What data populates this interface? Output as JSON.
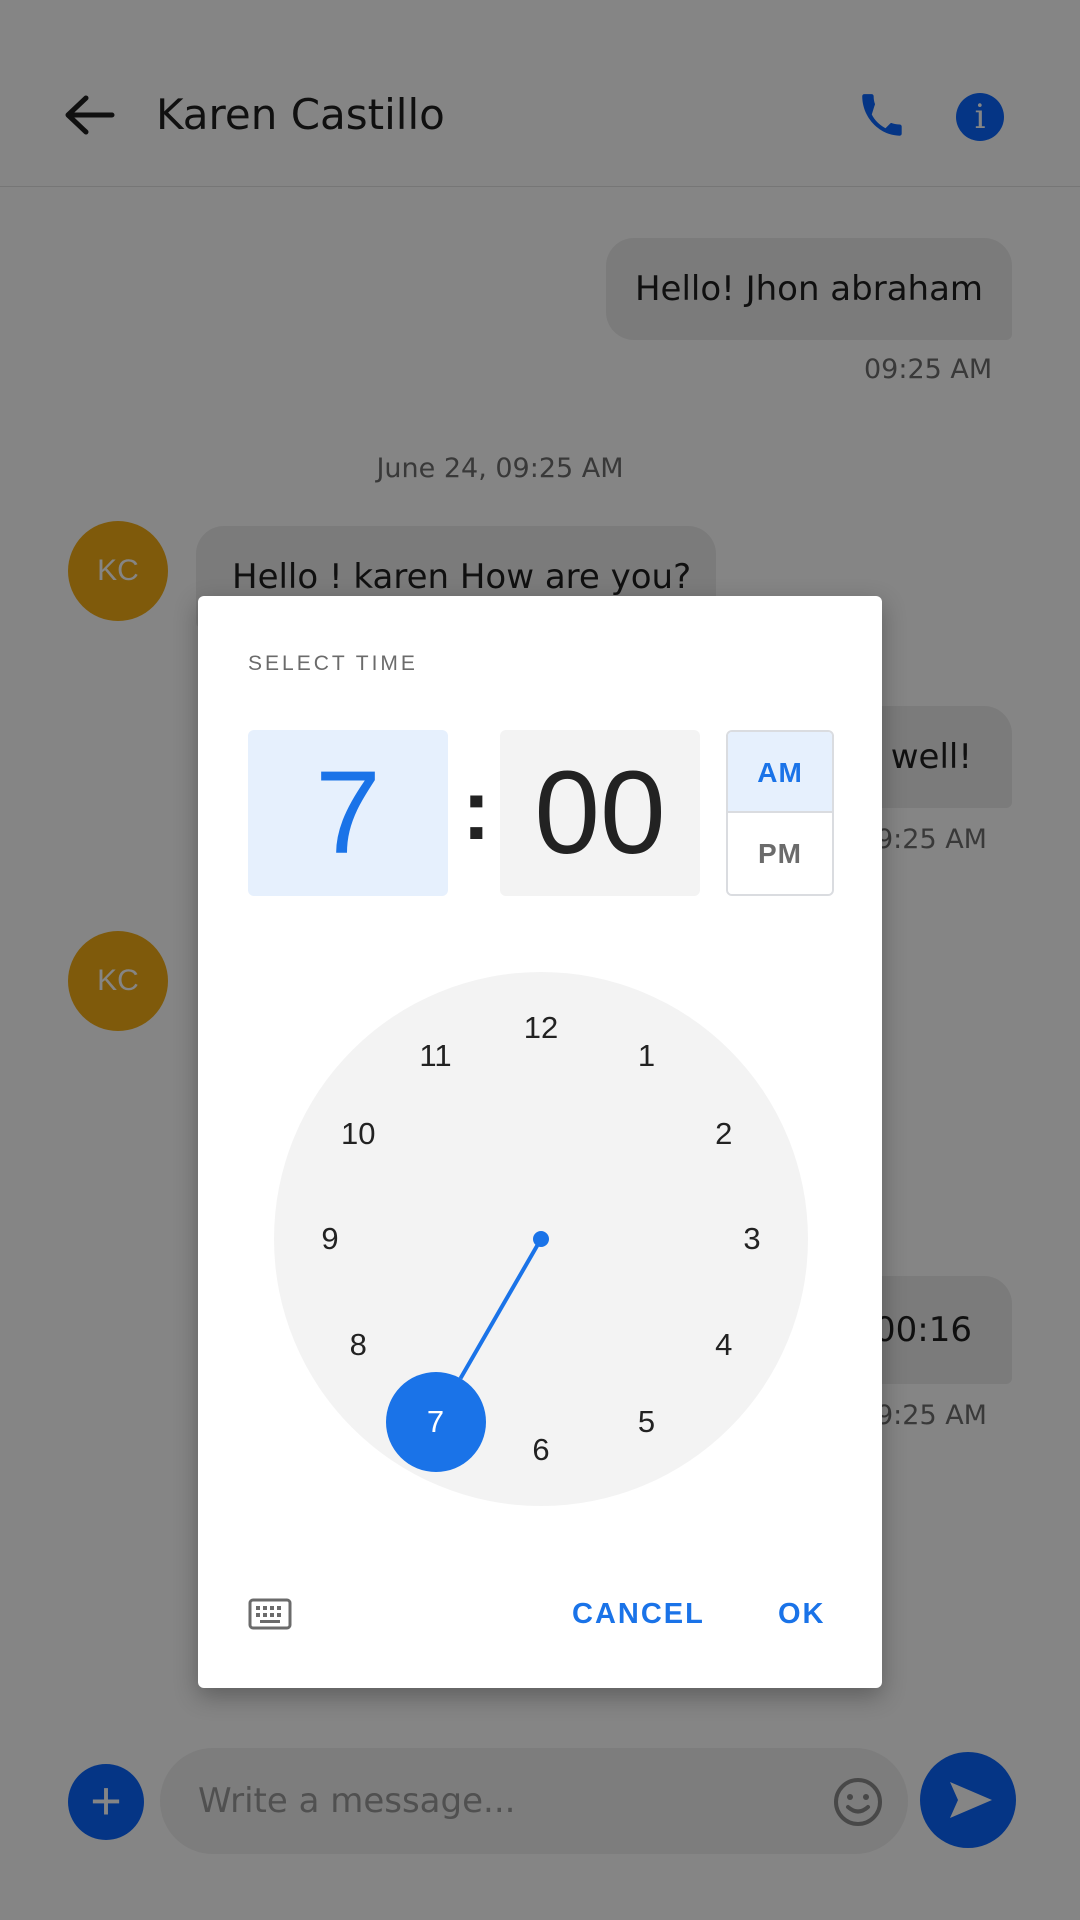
{
  "header": {
    "title": "Karen Castillo",
    "back_icon": "arrow-left-icon",
    "call_icon": "phone-icon",
    "info_icon": "info-icon",
    "info_glyph": "i"
  },
  "messages": {
    "outgoing_1": {
      "text": "Hello! Jhon abraham",
      "time": "09:25 AM"
    },
    "date_separator": "June 24, 09:25 AM",
    "incoming_1": {
      "avatar": "KC",
      "text": "Hello ! karen How are you?"
    },
    "outgoing_2": {
      "text": "well!",
      "time": "9:25 AM"
    },
    "incoming_2": {
      "avatar": "KC"
    },
    "outgoing_3": {
      "text": "00:16",
      "time": "9:25 AM"
    }
  },
  "composer": {
    "add_label": "+",
    "placeholder": "Write a message...",
    "emoji_icon": "smiley-icon",
    "send_icon": "send-icon"
  },
  "time_picker": {
    "title": "SELECT TIME",
    "hour": "7",
    "separator": ":",
    "minute": "00",
    "am_label": "AM",
    "pm_label": "PM",
    "selected_period": "AM",
    "clock_numbers": [
      "12",
      "1",
      "2",
      "3",
      "4",
      "5",
      "6",
      "7",
      "8",
      "9",
      "10",
      "11"
    ],
    "selected_hour": 7,
    "keyboard_icon": "keyboard-icon",
    "cancel_label": "CANCEL",
    "ok_label": "OK"
  },
  "colors": {
    "accent": "#1a73e8",
    "brand_blue": "#0a66ff",
    "avatar": "#f3ad16",
    "scrim": "rgba(0,0,0,0.48)"
  }
}
